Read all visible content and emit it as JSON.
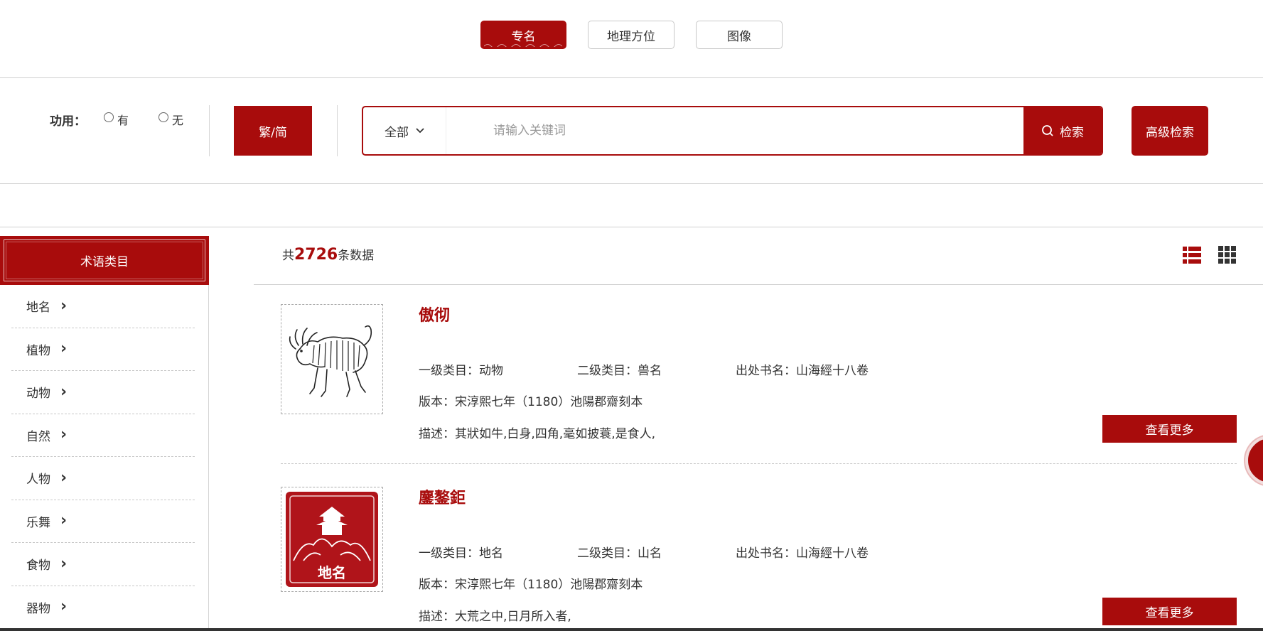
{
  "tabs": [
    {
      "label": "专名",
      "active": true
    },
    {
      "label": "地理方位",
      "active": false
    },
    {
      "label": "图像",
      "active": false
    }
  ],
  "search": {
    "function_label": "功用：",
    "options": [
      "有",
      "无"
    ],
    "traditional_simplified": "繁/简",
    "scope": "全部",
    "placeholder": "请输入关键词",
    "search_label": "检索",
    "advanced_label": "高级检索"
  },
  "sidebar": {
    "title": "术语类目",
    "items": [
      "地名",
      "植物",
      "动物",
      "自然",
      "人物",
      "乐舞",
      "食物",
      "器物"
    ]
  },
  "results": {
    "count_prefix": "共",
    "count": "2726",
    "count_suffix": "条数据",
    "items": [
      {
        "title": "傲彻",
        "level1": "一级类目：动物",
        "level2": "二级类目：兽名",
        "source": "出处书名：山海經十八卷",
        "edition": "版本：宋淳熙七年（1180）池陽郡齋刻本",
        "desc": "描述：其狀如牛,白身,四角,毫如披蓑,是食人,",
        "more": "查看更多"
      },
      {
        "title": "鏖鏊鉅",
        "level1": "一级类目：地名",
        "level2": "二级类目：山名",
        "source": "出处书名：山海經十八卷",
        "edition": "版本：宋淳熙七年（1180）池陽郡齋刻本",
        "desc": "描述：大荒之中,日月所入者,",
        "more": "查看更多",
        "stamp_text": "地名"
      }
    ]
  },
  "colors": {
    "accent": "#a80c0c"
  }
}
